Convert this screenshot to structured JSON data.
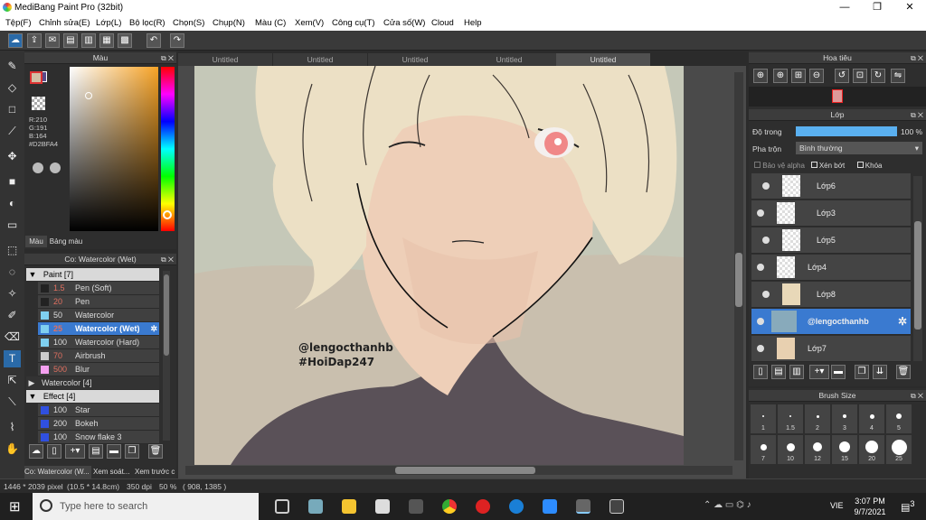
{
  "window": {
    "title": "MediBang Paint Pro (32bit)",
    "min": "—",
    "max": "❐",
    "close": "✕"
  },
  "menu": [
    "Tệp(F)",
    "Chỉnh sửa(E)",
    "Lớp(L)",
    "Bộ lọc(R)",
    "Chọn(S)",
    "Chụp(N)",
    "Màu (C)",
    "Xem(V)",
    "Công cụ(T)",
    "Cửa số(W)",
    "Cloud",
    "Help"
  ],
  "color": {
    "title": "Màu",
    "r": "R:210",
    "g": "G:191",
    "b": "B:164",
    "hex": "#D2BFA4",
    "tab1": "Màu",
    "tab2": "Bảng màu",
    "fg": "#d2bfa4",
    "bg": "#5a4a8a"
  },
  "brush": {
    "title": "Co: Watercolor (Wet)",
    "group1": "Paint [7]",
    "items": [
      {
        "size": "1.5",
        "name": "Pen (Soft)",
        "color": "#222222"
      },
      {
        "size": "20",
        "name": "Pen",
        "color": "#222222"
      },
      {
        "size": "50",
        "name": "Watercolor",
        "color": "#7fd0f0"
      },
      {
        "size": "25",
        "name": "Watercolor (Wet)",
        "color": "#7fd0f0"
      },
      {
        "size": "100",
        "name": "Watercolor (Hard)",
        "color": "#7fd0f0"
      },
      {
        "size": "70",
        "name": "Airbrush",
        "color": "#cccccc"
      },
      {
        "size": "500",
        "name": "Blur",
        "color": "#f5a0f0"
      }
    ],
    "group2": "Watercolor [4]",
    "group3": "Effect [4]",
    "effects": [
      {
        "size": "100",
        "name": "Star",
        "color": "#3050e0"
      },
      {
        "size": "200",
        "name": "Bokeh",
        "color": "#3050e0"
      },
      {
        "size": "100",
        "name": "Snow flake 3",
        "color": "#3050e0"
      }
    ],
    "bottom_tabs": [
      "Co: Watercolor (W...",
      "Xem soát...",
      "Xem trước c"
    ]
  },
  "tabs": [
    "Untitled",
    "Untitled",
    "Untitled",
    "Untitled",
    "Untitled"
  ],
  "canvas": {
    "sig1": "@lengocthanhb",
    "sig2": "#HoiDap247"
  },
  "navigator": {
    "title": "Hoa tiêu"
  },
  "layer": {
    "title": "Lớp",
    "opacity_label": "Độ trong",
    "opacity_value": "100 %",
    "opacity": 1.0,
    "blend_label": "Pha trộn",
    "blend_value": "Bình thường",
    "alpha": "Bảo vệ alpha",
    "clip": "Xén bớt",
    "lock": "Khóa",
    "rows": [
      "Lớp6",
      "Lớp3",
      "Lớp5",
      "Lớp4",
      "Lớp8",
      "@lengocthanhb",
      "Lớp7"
    ]
  },
  "size": {
    "title": "Brush Size",
    "labels": [
      "1",
      "1.5",
      "2",
      "3",
      "4",
      "5",
      "7",
      "10",
      "12",
      "15",
      "20",
      "25"
    ]
  },
  "status": {
    "dims": "1446 * 2039 pixel",
    "cm": "(10.5 * 14.8cm)",
    "dpi": "350 dpi",
    "zoom": "50 %",
    "coord": "( 908, 1385 )"
  },
  "taskbar": {
    "search": "Type here to search",
    "lang": "VIE",
    "time": "3:07 PM",
    "date": "9/7/2021",
    "notif": "3"
  }
}
